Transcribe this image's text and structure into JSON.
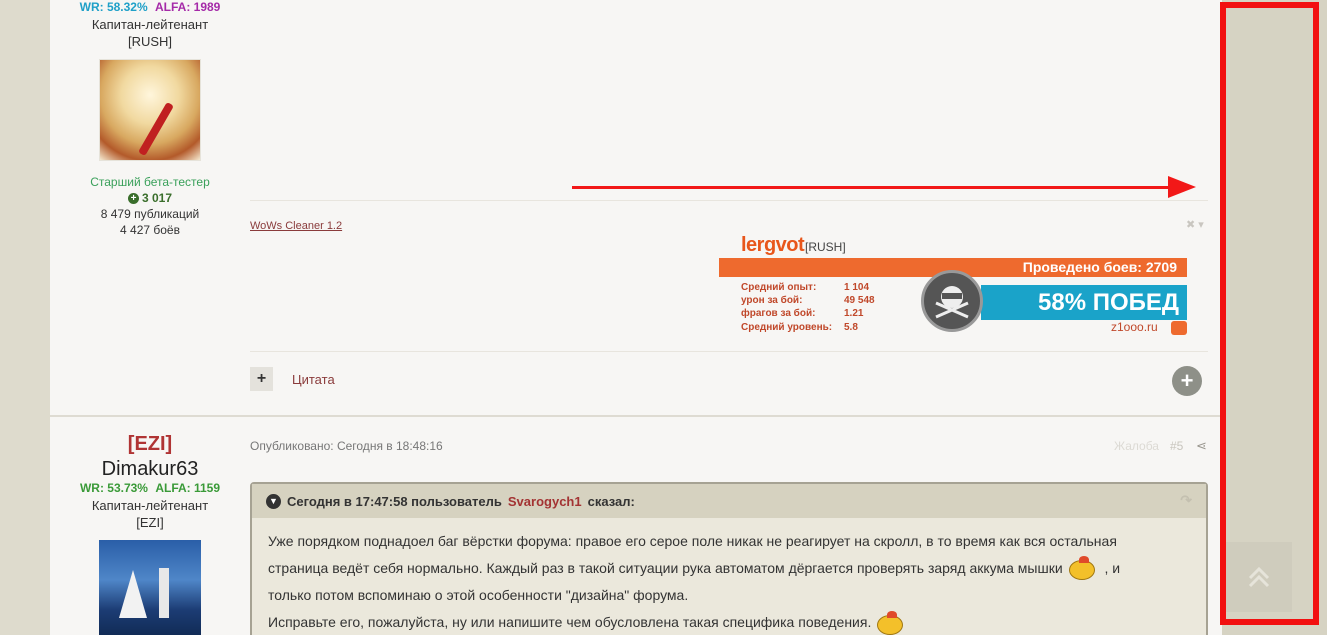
{
  "post1": {
    "author": {
      "wr": "WR: 58.32%",
      "alfa": "ALFA: 1989",
      "rank": "Капитан-лейтенант",
      "clan": "[RUSH]",
      "group": "Старший бета-тестер",
      "reputation": "3 017",
      "posts": "8 479 публикаций",
      "battles": "4 427 боёв"
    },
    "signature_link": "WoWs Cleaner 1.2",
    "banner": {
      "name": "lergvot",
      "clan": "[RUSH]",
      "battles_label": "Проведено боев: 2709",
      "stats": [
        {
          "label": "Средний опыт:",
          "value": "1 104"
        },
        {
          "label": "урон за бой:",
          "value": "49 548"
        },
        {
          "label": "фрагов за бой:",
          "value": "1.21"
        },
        {
          "label": "Средний уровень:",
          "value": "5.8"
        }
      ],
      "wins": "58% ПОБЕД",
      "site": "z1ooo.ru"
    },
    "quote_button": "Цитата"
  },
  "post2": {
    "author": {
      "clan": "[EZI]",
      "username": "Dimakur63",
      "wr": "WR: 53.73%",
      "alfa": "ALFA: 1159",
      "rank": "Капитан-лейтенант",
      "clan_tag": "[EZI]"
    },
    "published": "Опубликовано: Сегодня в 18:48:16",
    "report": "Жалоба",
    "post_number": "#5",
    "quote": {
      "header_prefix": "Сегодня в 17:47:58 пользователь",
      "user": "Svarogych1",
      "header_suffix": "сказал:",
      "line1": "Уже порядком поднадоел баг вёрстки форума: правое его серое поле никак не реагирует на скролл, в то время как вся остальная",
      "line2a": "страница ведёт себя нормально. Каждый раз в такой ситуации рука автоматом дёргается проверять заряд аккума мышки",
      "line2b": ", и",
      "line3": "только потом вспоминаю о этой особенности \"дизайна\" форума.",
      "line4": "Исправьте его, пожалуйста, ну или напишите чем обусловлена такая специфика поведения."
    }
  },
  "colors": {
    "highlight_frame": "#f21010",
    "arrow": "#f21818",
    "banner_orange": "#ee6a2e",
    "banner_blue": "#1aa3c9"
  }
}
